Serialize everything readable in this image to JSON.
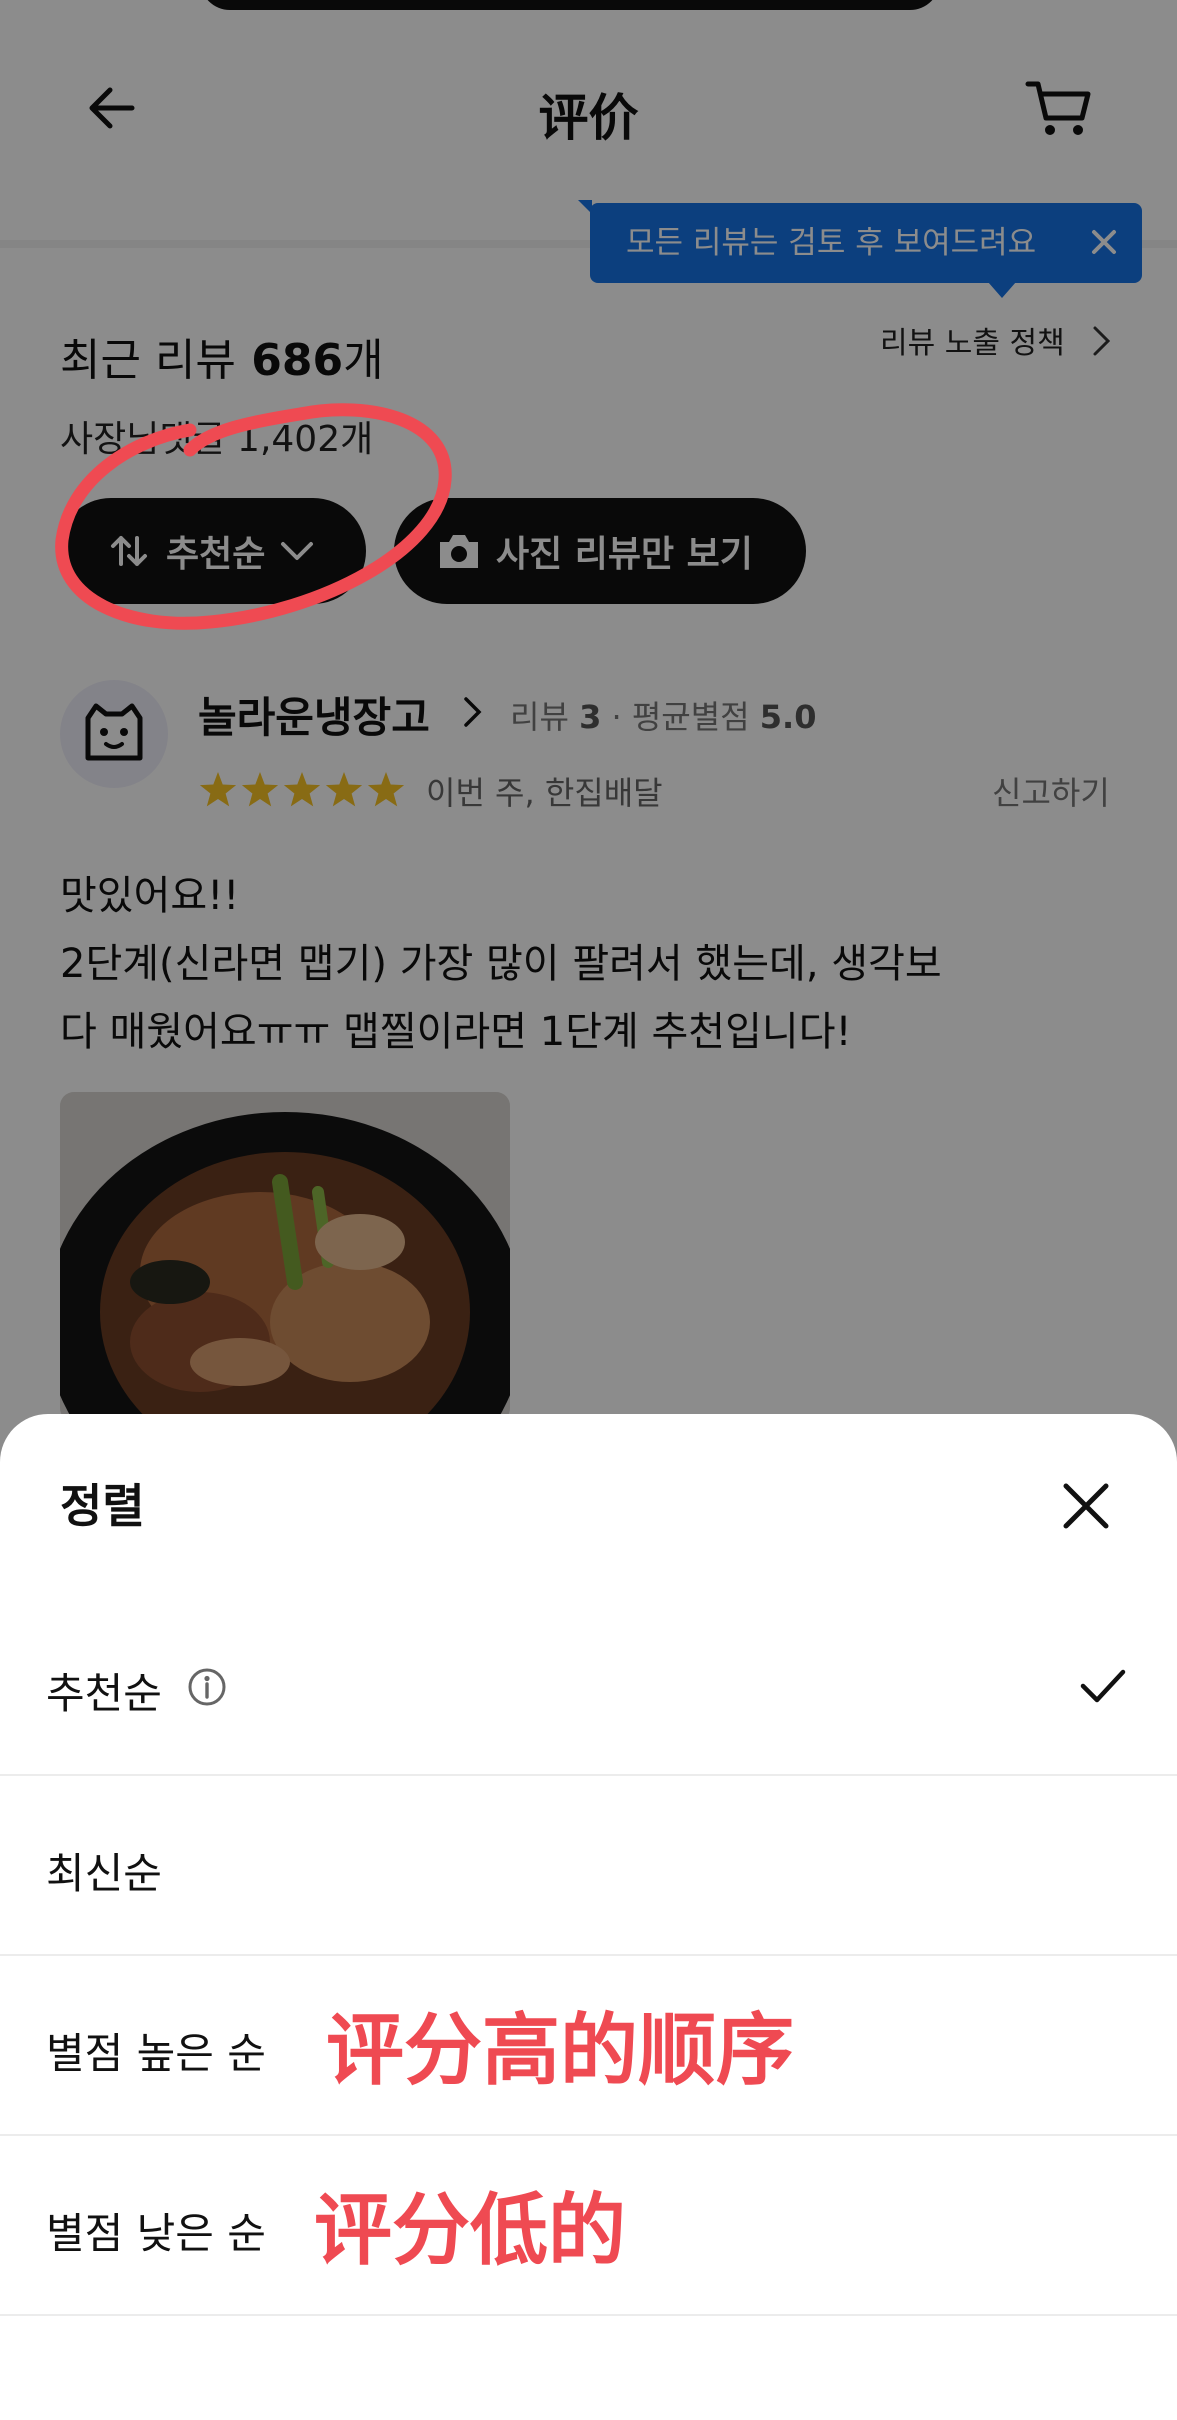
{
  "header": {
    "title": "评价"
  },
  "tooltip": {
    "text": "모든 리뷰는 검토 후 보여드려요"
  },
  "summary": {
    "recent_label": "최근 리뷰",
    "recent_count": "686",
    "recent_unit": "개",
    "policy_link": "리뷰 노출 정책",
    "owner_reply": "사장님댓글 1,402개"
  },
  "filters": {
    "sort_label": "추천순",
    "photo_label": "사진 리뷰만 보기"
  },
  "review": {
    "nickname": "놀라운냉장고",
    "review_label": "리뷰",
    "review_count": "3",
    "avg_label": "평균별점",
    "avg_value": "5.0",
    "rating": 5,
    "meta": "이번 주, 한집배달",
    "report": "신고하기",
    "line1": "맛있어요!!",
    "line2": "2단계(신라면 맵기) 가장 많이 팔려서 했는데, 생각보",
    "line3": "다 매웠어요ㅠㅠ 맵찔이라면 1단계 추천입니다!"
  },
  "sheet": {
    "title": "정렬",
    "options": [
      {
        "label": "추천순",
        "selected": true
      },
      {
        "label": "최신순",
        "selected": false
      },
      {
        "label": "별점 높은 순",
        "selected": false
      },
      {
        "label": "별점 낮은 순",
        "selected": false
      }
    ]
  },
  "annotations": {
    "high": "评分高的顺序",
    "low": "评分低的"
  },
  "colors": {
    "tooltip": "#1673e6",
    "star": "#f7c325",
    "annotation": "#ef4a52",
    "chip": "#111111"
  }
}
